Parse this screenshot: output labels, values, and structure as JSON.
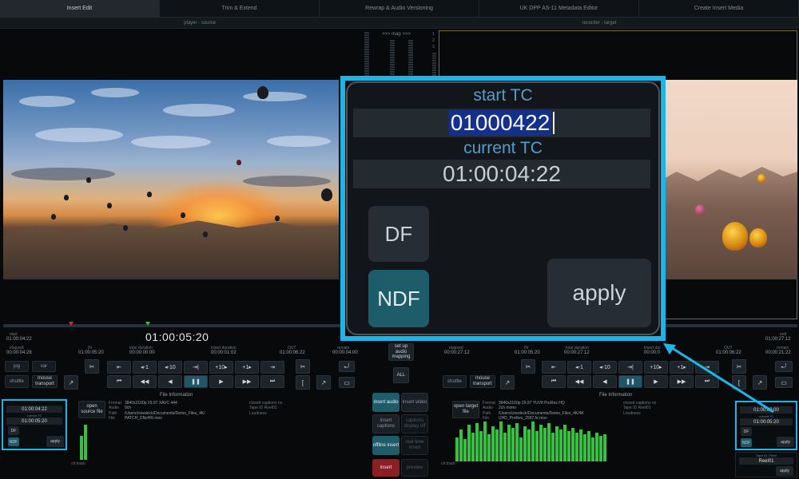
{
  "tabs": [
    {
      "label": "Insert Edit",
      "active": true
    },
    {
      "label": "Trim & Extend",
      "active": false
    },
    {
      "label": "Rewrap & Audio Versioning",
      "active": false
    },
    {
      "label": "UK DPP AS-11 Metadata Editor",
      "active": false
    },
    {
      "label": "Create Insert Media",
      "active": false
    }
  ],
  "subbar": {
    "player": "player - source",
    "recorder": "recorder - target"
  },
  "map": {
    "title": ">>> map >>>",
    "numbers": [
      "1",
      "2",
      "3"
    ]
  },
  "player": {
    "start_label": "start",
    "start_tc": "01:00:04:22",
    "elapsed_label": "elapsed",
    "elapsed_tc": "00:00:04:28",
    "in_label": "IN",
    "in_tc": "01:00:05:20",
    "total_duration_label": "total duration",
    "total_duration": "00:00:00:00",
    "insert_duration_label": "insert duration",
    "insert_duration": "00:00:01:02",
    "out_label": "OUT",
    "out_tc": "01:00:06:22",
    "remain_label": "remain",
    "remain_tc": "00:00:04:00",
    "current_tc": "01:00:05:20",
    "jog": "jog",
    "var": "var",
    "shuttle": "shuttle",
    "mouse_transport": "mouse transport",
    "transport": [
      "⇤",
      "◂-1",
      "◂-10",
      "⇥|",
      "+10▸",
      "+1▸",
      "⇥"
    ],
    "transport2": [
      "⏮",
      "◀◀",
      "◀",
      "❚❚",
      "▶",
      "▶▶",
      "⏭"
    ],
    "file_info_title": "File Information",
    "open_file": "open source file",
    "file_info": {
      "format_label": "Format",
      "format": "3840x2160p 29.97 XAVC 444",
      "audio_label": "Audio",
      "audio": "0ch",
      "path_label": "Path",
      "path": "/Users/cinedeck/Documents/Demo_Files_4K/",
      "file_label": "File",
      "file": "PATCH_DNxHR.mov",
      "closed_captions_label": "closed captions",
      "closed_captions": "no",
      "tape_id_label": "Tape ID",
      "tape_id": "Reel01",
      "loudness_label": "Loudness",
      "loudness": "Low Rating"
    },
    "track_label": "ch track",
    "tc_panel": {
      "start_tc": "01:00:04:22",
      "current_label": "current TC",
      "current_tc": "01:00:05:20",
      "df": "DF",
      "ndf": "NDF",
      "apply": "apply"
    }
  },
  "center": {
    "setup_audio_mapping": "set up audio mapping",
    "all": "ALL",
    "buttons": [
      {
        "label": "insert audio",
        "style": "teal"
      },
      {
        "label": "insert video",
        "style": "dark"
      },
      {
        "label": "insert captions",
        "style": "dark"
      },
      {
        "label": "captions display off",
        "style": "ghost"
      },
      {
        "label": "offline insert",
        "style": "teal"
      },
      {
        "label": "real time insert",
        "style": "ghost"
      },
      {
        "label": "insert",
        "style": "red"
      },
      {
        "label": "preview",
        "style": "ghost"
      }
    ]
  },
  "recorder": {
    "end_label": "end",
    "end_tc": "01:00:27:12",
    "elapsed_label": "elapsed",
    "elapsed_tc": "00:00:27:12",
    "in_label": "IN",
    "in_tc": "01:00:05:20",
    "total_duration_label": "total duration",
    "total_duration": "00:00:27:12",
    "insert_duration_label": "insert dur",
    "insert_duration": "00:00:0",
    "out_label": "OUT",
    "out_tc": "01:00:06:22",
    "remain_label": "remain",
    "remain_tc": "00:00:21:22",
    "shuttle": "shuttle",
    "mouse_transport": "mouse transport",
    "transport": [
      "⇤",
      "◂-1",
      "◂-10",
      "⇥|",
      "+10▸",
      "+1▸",
      "⇥"
    ],
    "transport2": [
      "⏮",
      "◀◀",
      "◀",
      "❚❚",
      "▶",
      "▶▶",
      "⏭"
    ],
    "file_info_title": "File Information",
    "open_file": "open target file",
    "file_info": {
      "format_label": "Format",
      "format": "3840x2160p 29.97 YUV8 ProRes HQ",
      "audio_label": "Audio",
      "audio": "2ch mono",
      "path_label": "Path",
      "path": "/Users/cinedeck/Documents/Demo_Files_4K/4K",
      "file_label": "File",
      "file": "UHD_ProRes_2997.hr.mov",
      "closed_captions_label": "closed captions",
      "closed_captions": "no",
      "tape_id_label": "Tape ID",
      "tape_id": "Reel01",
      "loudness_label": "Loudness",
      "loudness": "Low Rating"
    },
    "track_label": "ch track",
    "tc_panel": {
      "start_tc": "01:00:00:00",
      "current_label": "current TC",
      "current_tc": "01:00:05:20",
      "df": "DF",
      "ndf": "NDF",
      "apply": "apply"
    },
    "tape_id_panel": {
      "label": "Tape ID / Reel",
      "value": "Reel01",
      "apply": "apply"
    }
  },
  "zoom": {
    "start_label": "start TC",
    "start_value": "01000422",
    "current_label": "current TC",
    "current_value": "01:00:04:22",
    "df": "DF",
    "ndf": "NDF",
    "apply": "apply"
  },
  "colors": {
    "highlight": "#1db5e8",
    "teal": "#1d5d6a",
    "insert_red": "#8a1f26",
    "meter_green": "#36c23e"
  }
}
